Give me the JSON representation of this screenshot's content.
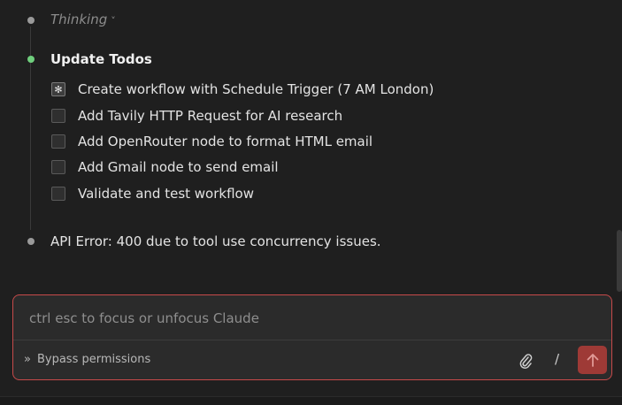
{
  "thinking": {
    "label": "Thinking",
    "chevron": "˅"
  },
  "todos_title": "Update Todos",
  "todos": [
    {
      "label": "Create workflow with Schedule Trigger (7 AM London)",
      "status": "in_progress",
      "mark": "✻"
    },
    {
      "label": "Add Tavily HTTP Request for AI research",
      "status": "pending",
      "mark": ""
    },
    {
      "label": "Add OpenRouter node to format HTML email",
      "status": "pending",
      "mark": ""
    },
    {
      "label": "Add Gmail node to send email",
      "status": "pending",
      "mark": ""
    },
    {
      "label": "Validate and test workflow",
      "status": "pending",
      "mark": ""
    }
  ],
  "error_message": "API Error: 400 due to tool use concurrency issues.",
  "composer": {
    "placeholder": "ctrl esc to focus or unfocus Claude",
    "mode_chevron": "»",
    "mode_label": "Bypass permissions",
    "slash": "/",
    "attach_icon": "paperclip-icon",
    "send_icon": "arrow-up-icon"
  },
  "colors": {
    "accent_border": "#c74a4a",
    "send_button": "#9e3a36",
    "dot_active": "#6fcf7d",
    "dot_default": "#9a9a9a"
  }
}
